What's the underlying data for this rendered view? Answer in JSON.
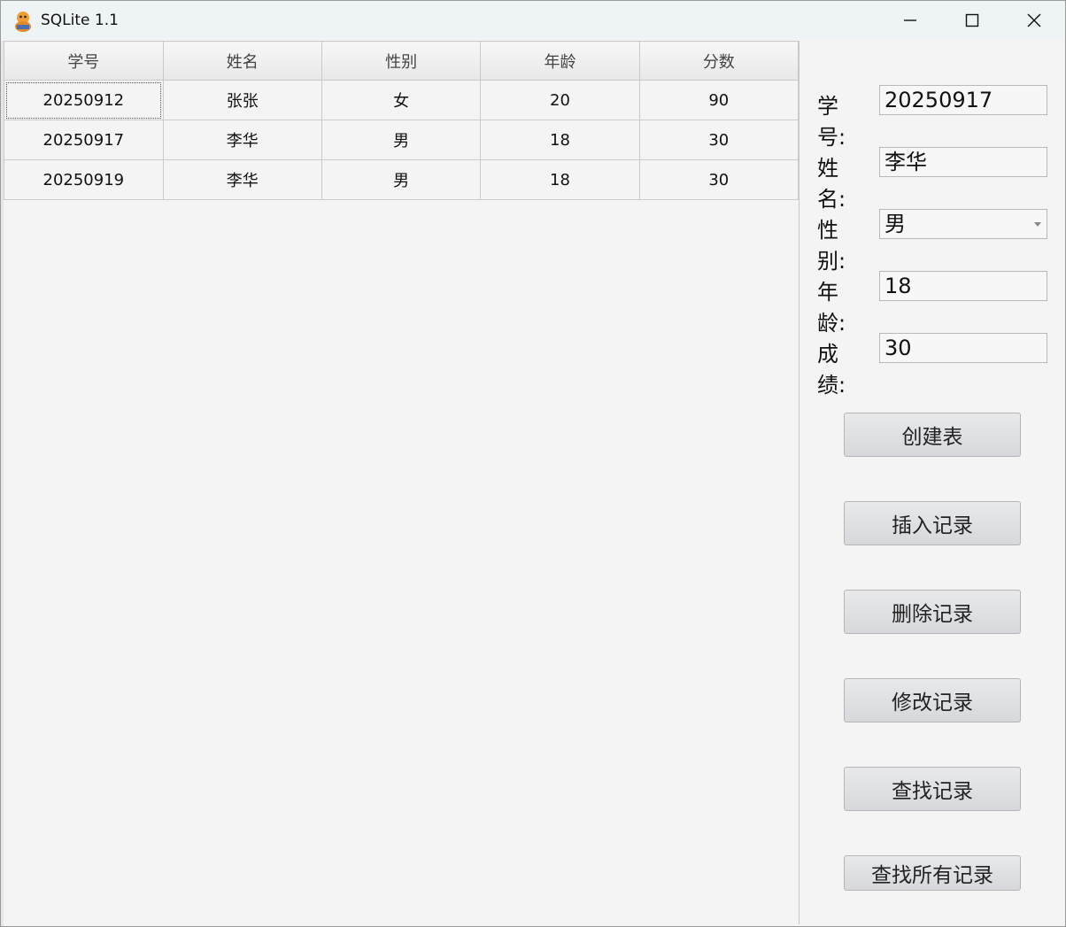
{
  "window": {
    "title": "SQLite 1.1"
  },
  "table": {
    "columns": [
      "学号",
      "姓名",
      "性别",
      "年龄",
      "分数"
    ],
    "rows": [
      [
        "20250912",
        "张张",
        "女",
        "20",
        "90"
      ],
      [
        "20250917",
        "李华",
        "男",
        "18",
        "30"
      ],
      [
        "20250919",
        "李华",
        "男",
        "18",
        "30"
      ]
    ]
  },
  "form": {
    "student_id": {
      "label": "学号:",
      "value": "20250917"
    },
    "name": {
      "label": "姓名:",
      "value": "李华"
    },
    "gender": {
      "label": "性别:",
      "value": "男"
    },
    "age": {
      "label": "年龄:",
      "value": "18"
    },
    "score": {
      "label": "成绩:",
      "value": "30"
    }
  },
  "buttons": {
    "create_table": "创建表",
    "insert": "插入记录",
    "delete": "删除记录",
    "update": "修改记录",
    "find": "查找记录",
    "find_all": "查找所有记录"
  },
  "icons": {
    "app": "app-icon",
    "minimize": "minimize-icon",
    "maximize": "maximize-icon",
    "close": "close-icon"
  }
}
